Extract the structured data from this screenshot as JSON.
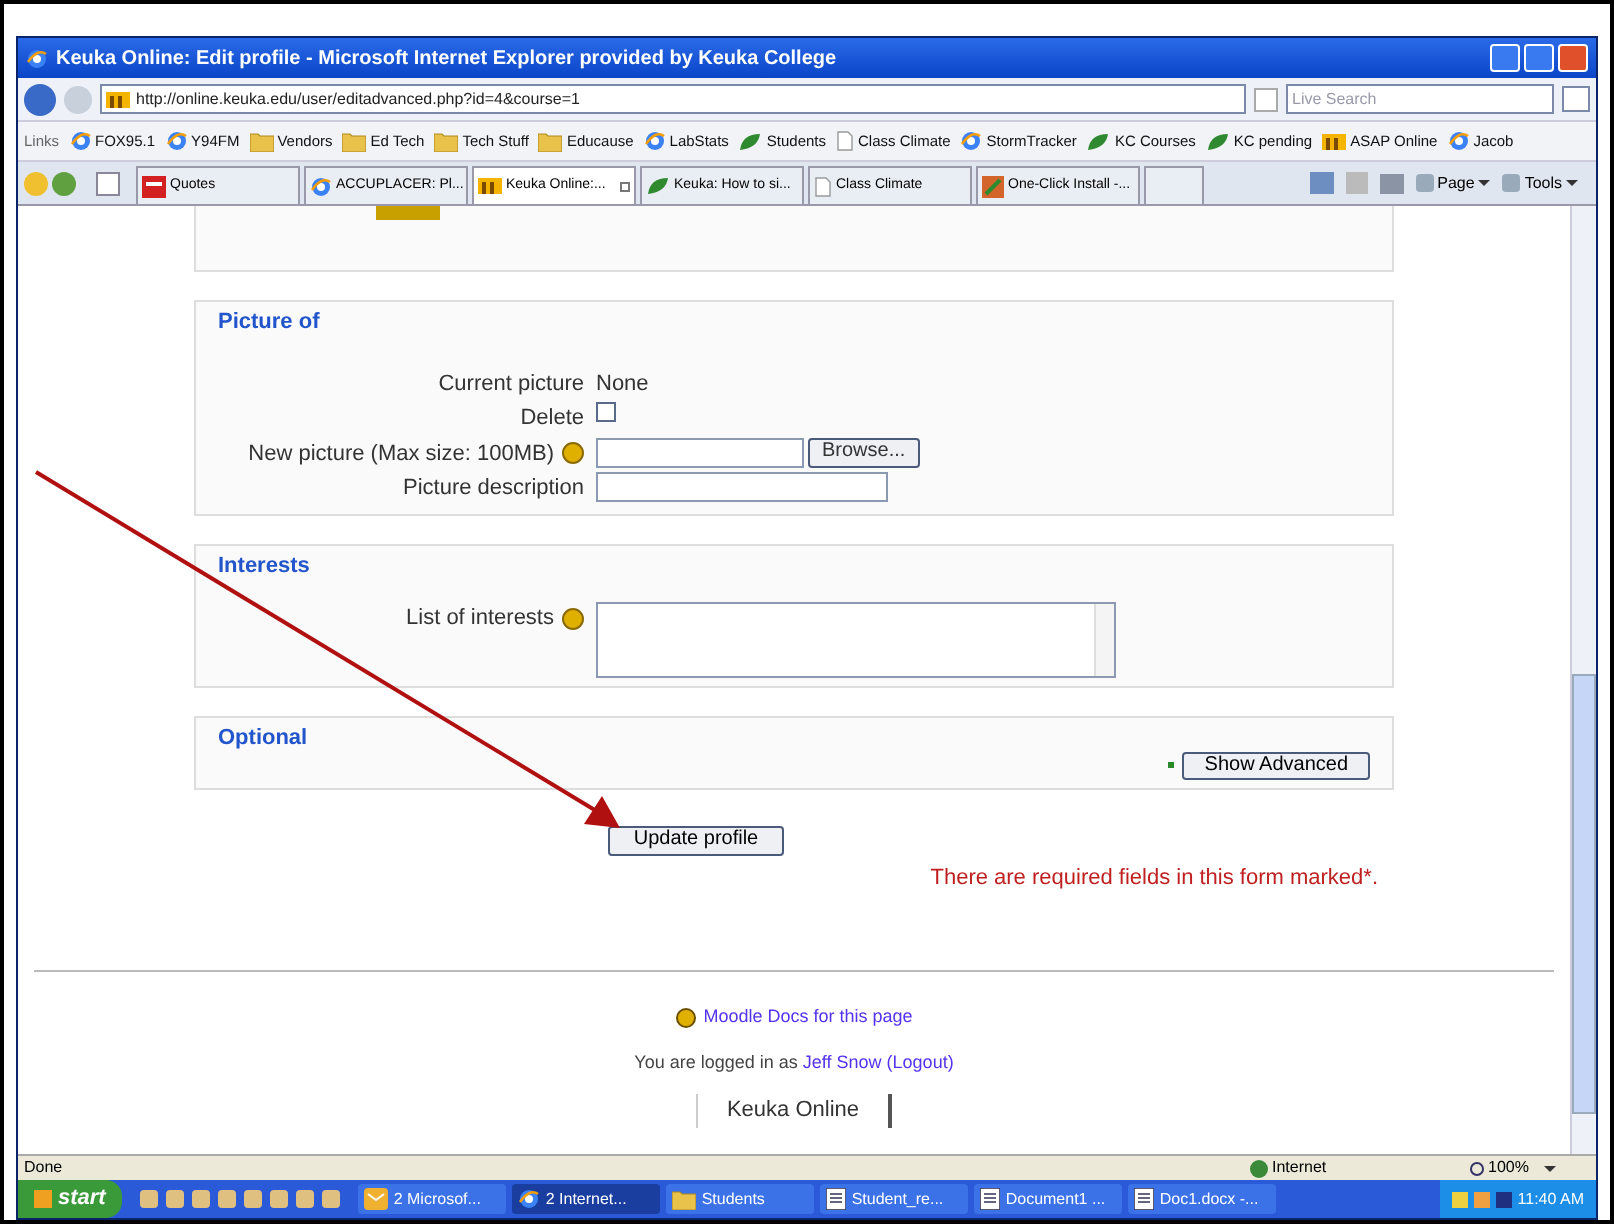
{
  "window": {
    "title": "Keuka Online: Edit profile - Microsoft Internet Explorer provided by Keuka College"
  },
  "address_bar": {
    "url": "http://online.keuka.edu/user/editadvanced.php?id=4&course=1",
    "search_placeholder": "Live Search"
  },
  "links_bar": {
    "label": "Links",
    "items": [
      {
        "label": "FOX95.1",
        "kind": "ie"
      },
      {
        "label": "Y94FM",
        "kind": "ie"
      },
      {
        "label": "Vendors",
        "kind": "folder"
      },
      {
        "label": "Ed Tech",
        "kind": "folder"
      },
      {
        "label": "Tech Stuff",
        "kind": "folder"
      },
      {
        "label": "Educause",
        "kind": "folder"
      },
      {
        "label": "LabStats",
        "kind": "ie"
      },
      {
        "label": "Students",
        "kind": "kc"
      },
      {
        "label": "Class Climate",
        "kind": "cc"
      },
      {
        "label": "StormTracker",
        "kind": "ie"
      },
      {
        "label": "KC Courses",
        "kind": "kc"
      },
      {
        "label": "KC pending",
        "kind": "kc"
      },
      {
        "label": "ASAP Online",
        "kind": "tm"
      },
      {
        "label": "Jacob",
        "kind": "ie"
      }
    ]
  },
  "tabs": [
    {
      "label": "Quotes",
      "kind": "quotes",
      "selected": false
    },
    {
      "label": "ACCUPLACER: Pl...",
      "kind": "ie",
      "selected": false
    },
    {
      "label": "Keuka Online:...",
      "kind": "tm",
      "selected": true
    },
    {
      "label": "Keuka: How to si...",
      "kind": "kc",
      "selected": false
    },
    {
      "label": "Class Climate",
      "kind": "cc",
      "selected": false
    },
    {
      "label": "One-Click Install -...",
      "kind": "install",
      "selected": false
    }
  ],
  "command_bar": [
    {
      "label": "Page"
    },
    {
      "label": "Tools"
    }
  ],
  "sections": [
    {
      "title": "Picture of",
      "kind": "picture",
      "rows": [
        {
          "label": "Current picture",
          "kind": "text",
          "value": "None"
        },
        {
          "label": "Delete",
          "kind": "checkbox",
          "checked": false
        },
        {
          "label": "New picture (Max size: 100MB)",
          "kind": "file",
          "help": true,
          "button": "Browse..."
        },
        {
          "label": "Picture description",
          "kind": "input"
        }
      ]
    },
    {
      "title": "Interests",
      "kind": "interests",
      "rows": [
        {
          "label": "List of interests",
          "kind": "textarea",
          "help": true
        }
      ]
    },
    {
      "title": "Optional",
      "kind": "optional",
      "button": "Show Advanced"
    }
  ],
  "submit": "Update profile",
  "required_note": "There are required fields in this form marked*.",
  "footer": {
    "docs_link": "Moodle Docs for this page",
    "logged_prefix": "You are logged in as",
    "user": "Jeff Snow",
    "logout": "(Logout)",
    "site": "Keuka Online"
  },
  "status_bar": {
    "status": "Done",
    "zone": "Internet",
    "zoom": "100%"
  },
  "taskbar": {
    "start": "start",
    "tasks": [
      {
        "label": "2 Microsof...",
        "kind": "outlook",
        "selected": false
      },
      {
        "label": "2 Internet...",
        "kind": "ie",
        "selected": true
      },
      {
        "label": "Students",
        "kind": "folder",
        "selected": false
      },
      {
        "label": "Student_re...",
        "kind": "doc",
        "selected": false
      },
      {
        "label": "Document1 ...",
        "kind": "doc",
        "selected": false
      },
      {
        "label": "Doc1.docx -...",
        "kind": "doc",
        "selected": false
      }
    ],
    "clock": "11:40 AM"
  }
}
